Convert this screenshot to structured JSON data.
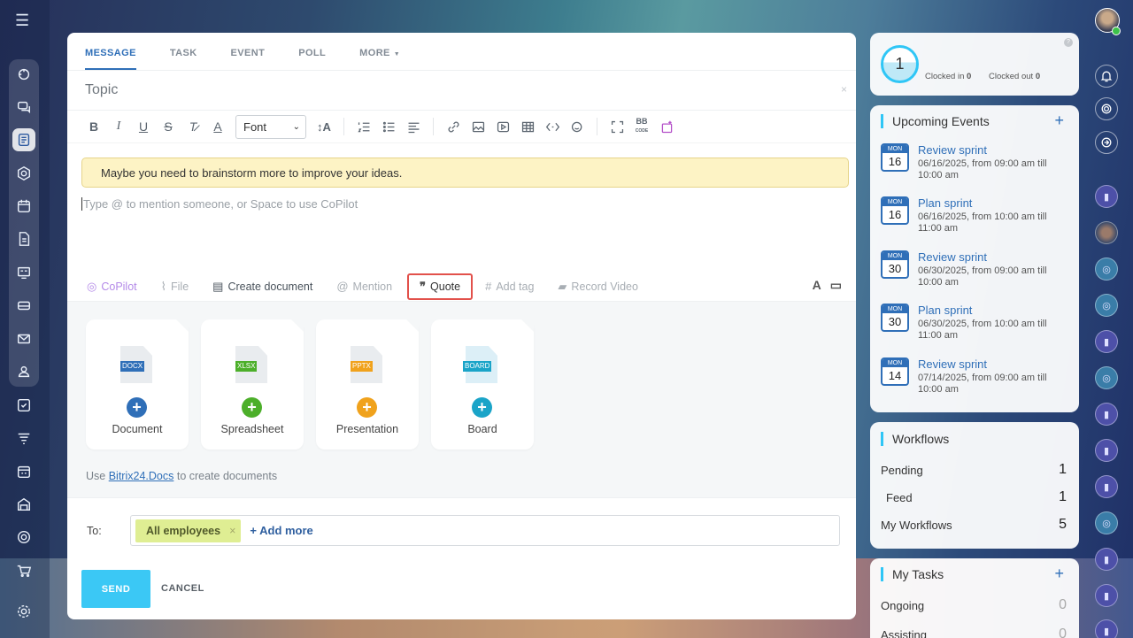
{
  "tabs": {
    "message": "MESSAGE",
    "task": "TASK",
    "event": "EVENT",
    "poll": "POLL",
    "more": "MORE"
  },
  "topic": {
    "placeholder": "Topic",
    "clear": "×"
  },
  "toolbar": {
    "font": "Font"
  },
  "banner": "Maybe you need to brainstorm more to improve your ideas.",
  "editor": {
    "placeholder": "Type @ to mention someone, or Space to use CoPilot"
  },
  "attach": {
    "copilot": "CoPilot",
    "file": "File",
    "create_document": "Create document",
    "mention": "Mention",
    "quote": "Quote",
    "add_tag": "Add tag",
    "record_video": "Record Video"
  },
  "docs": [
    {
      "tag": "DOCX",
      "label": "Document",
      "color": "#2f6fb8"
    },
    {
      "tag": "XLSX",
      "label": "Spreadsheet",
      "color": "#4caf2a"
    },
    {
      "tag": "PPTX",
      "label": "Presentation",
      "color": "#f0a21c"
    },
    {
      "tag": "BOARD",
      "label": "Board",
      "color": "#1aa4c8"
    }
  ],
  "docs_note": {
    "prefix": "Use",
    "link": "Bitrix24.Docs",
    "suffix": "to create documents"
  },
  "to": {
    "label": "To:",
    "chip": "All employees",
    "chip_x": "×",
    "add_more": "+ Add more"
  },
  "actions": {
    "send": "SEND",
    "cancel": "CANCEL"
  },
  "clock": {
    "value": "1",
    "clocked_in_label": "Clocked in",
    "clocked_in": "0",
    "clocked_out_label": "Clocked out",
    "clocked_out": "0",
    "help": "?"
  },
  "events": {
    "title": "Upcoming Events",
    "plus": "+",
    "items": [
      {
        "month": "MON",
        "day": "16",
        "title": "Review sprint",
        "line1": "06/16/2025, from 09:00 am till",
        "line2": "10:00 am"
      },
      {
        "month": "MON",
        "day": "16",
        "title": "Plan sprint",
        "line1": "06/16/2025, from 10:00 am till",
        "line2": "11:00 am"
      },
      {
        "month": "MON",
        "day": "30",
        "title": "Review sprint",
        "line1": "06/30/2025, from 09:00 am till",
        "line2": "10:00 am"
      },
      {
        "month": "MON",
        "day": "30",
        "title": "Plan sprint",
        "line1": "06/30/2025, from 10:00 am till",
        "line2": "11:00 am"
      },
      {
        "month": "MON",
        "day": "14",
        "title": "Review sprint",
        "line1": "07/14/2025, from 09:00 am till",
        "line2": "10:00 am"
      }
    ]
  },
  "workflows": {
    "title": "Workflows",
    "rows": [
      {
        "label": "Pending",
        "count": "1"
      },
      {
        "label": "Feed",
        "count": "1"
      },
      {
        "label": "My Workflows",
        "count": "5"
      }
    ]
  },
  "tasks": {
    "title": "My Tasks",
    "plus": "+",
    "rows": [
      {
        "label": "Ongoing",
        "count": "0"
      },
      {
        "label": "Assisting",
        "count": "0"
      }
    ]
  },
  "colors": {
    "accent": "#2f6fb8",
    "send": "#3bc8f5",
    "banner": "#fdf3c5",
    "chip": "#dfee93",
    "quote_highlight": "#e2514b"
  }
}
